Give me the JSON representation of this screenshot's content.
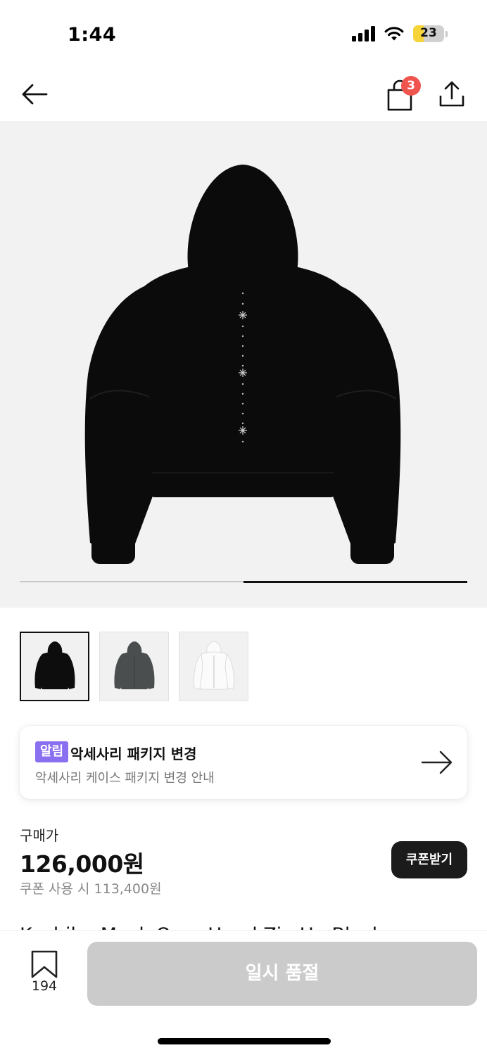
{
  "status_bar": {
    "time": "1:44",
    "battery_level": "23"
  },
  "nav": {
    "cart_count": "3",
    "icons": [
      "back-arrow-icon",
      "shopping-bag-icon",
      "share-icon"
    ]
  },
  "hero": {
    "image": "black-hoodie-back-view",
    "carousel_page": 2,
    "carousel_total": 2
  },
  "thumbnails": [
    {
      "color": "black",
      "selected": true
    },
    {
      "color": "charcoal",
      "selected": false
    },
    {
      "color": "white",
      "selected": false
    }
  ],
  "notice": {
    "badge": "알림",
    "title": "악세사리 패키지 변경",
    "subtitle": "악세사리 케이스 패키지 변경 안내"
  },
  "price": {
    "label": "구매가",
    "value": "126,000원",
    "coupon_price": "쿠폰 사용 시 113,400원",
    "coupon_button": "쿠폰받기"
  },
  "product": {
    "name": "Kashiba Mock Over Hood Zip Up Black"
  },
  "bottom_bar": {
    "bookmark_count": "194",
    "purchase_button": "일시 품절"
  },
  "colors": {
    "badge": "#8a6ff0",
    "cart_badge": "#f0544f",
    "disabled_button": "#cbcbcb",
    "battery": "#f6d438"
  }
}
